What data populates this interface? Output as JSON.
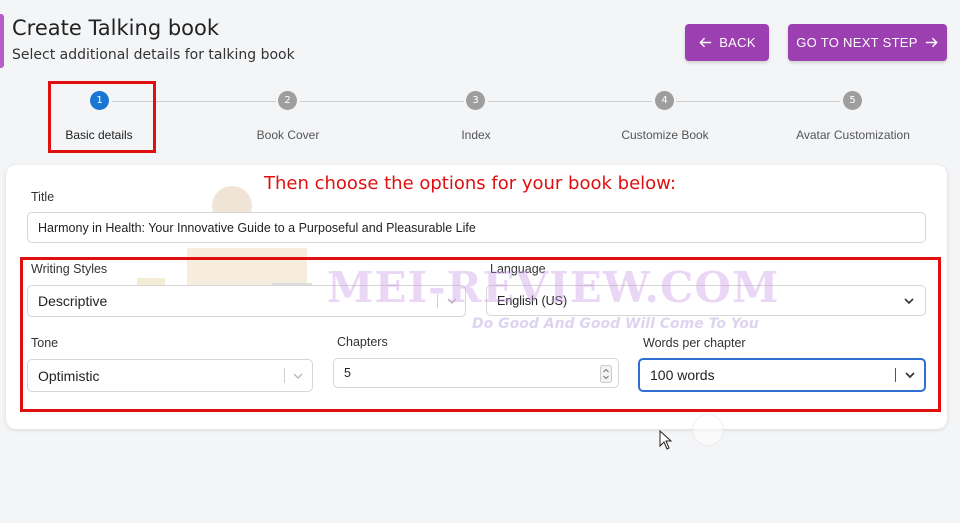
{
  "header": {
    "title": "Create Talking book",
    "subtitle": "Select additional details for talking book",
    "back_label": "BACK",
    "next_label": "GO TO NEXT STEP"
  },
  "stepper": {
    "steps": [
      {
        "number": "1",
        "label": "Basic details",
        "active": true
      },
      {
        "number": "2",
        "label": "Book Cover",
        "active": false
      },
      {
        "number": "3",
        "label": "Index",
        "active": false
      },
      {
        "number": "4",
        "label": "Customize Book",
        "active": false
      },
      {
        "number": "5",
        "label": "Avatar Customization",
        "active": false
      }
    ]
  },
  "annotation": {
    "instruction": "Then choose the options for your book below:"
  },
  "form": {
    "title_label": "Title",
    "title_value": "Harmony in Health: Your Innovative Guide to a Purposeful and Pleasurable Life",
    "writing_styles_label": "Writing Styles",
    "writing_styles_value": "Descriptive",
    "language_label": "Language",
    "language_value": "English (US)",
    "tone_label": "Tone",
    "tone_value": "Optimistic",
    "chapters_label": "Chapters",
    "chapters_value": "5",
    "words_label": "Words per chapter",
    "words_value": "100 words"
  },
  "watermark": {
    "text": "MEI-REVIEW.COM",
    "tagline": "Do Good And Good Will Come To You"
  },
  "colors": {
    "primary_button": "#9c3fb0",
    "active_step": "#1976d2",
    "annotation_red": "#e01010"
  }
}
